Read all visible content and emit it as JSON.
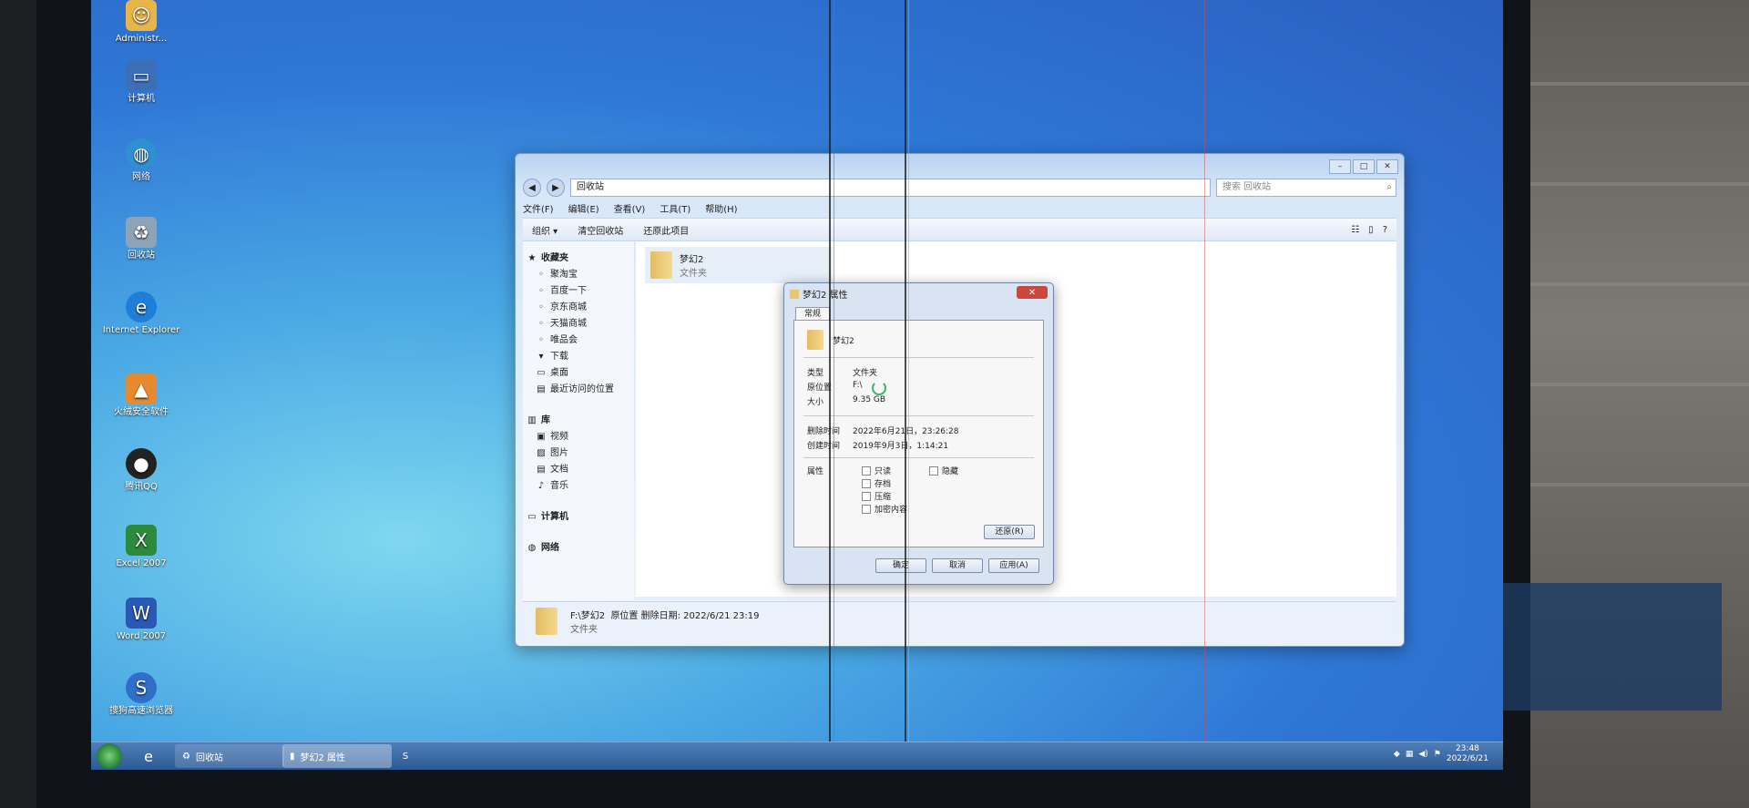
{
  "desktop_icons": [
    {
      "label": "Administr...",
      "icon": "user-icon"
    },
    {
      "label": "计算机",
      "icon": "computer-icon"
    },
    {
      "label": "网络",
      "icon": "network-icon"
    },
    {
      "label": "回收站",
      "icon": "recycle-bin-icon"
    },
    {
      "label": "Internet Explorer",
      "icon": "ie-icon"
    },
    {
      "label": "火绒安全软件",
      "icon": "huorong-icon"
    },
    {
      "label": "腾讯QQ",
      "icon": "qq-icon"
    },
    {
      "label": "Excel 2007",
      "icon": "excel-icon"
    },
    {
      "label": "Word 2007",
      "icon": "word-icon"
    },
    {
      "label": "搜狗高速浏览器",
      "icon": "sogou-icon"
    }
  ],
  "explorer": {
    "address": "回收站",
    "search_placeholder": "搜索 回收站",
    "menu": [
      "文件(F)",
      "编辑(E)",
      "查看(V)",
      "工具(T)",
      "帮助(H)"
    ],
    "toolbar": {
      "organize": "组织 ▾",
      "empty": "清空回收站",
      "restore": "还原此项目"
    },
    "nav": {
      "favorites_title": "收藏夹",
      "favorites": [
        "聚淘宝",
        "百度一下",
        "京东商城",
        "天猫商城",
        "唯品会",
        "下载",
        "桌面",
        "最近访问的位置"
      ],
      "library_title": "库",
      "library": [
        "视频",
        "图片",
        "文档",
        "音乐"
      ],
      "computer": "计算机",
      "network": "网络"
    },
    "file": {
      "name": "梦幻2",
      "type": "文件夹"
    },
    "status": {
      "path": "F:\\梦幻2",
      "date_label": "原位置  删除日期: 2022/6/21 23:19",
      "type": "文件夹"
    }
  },
  "properties": {
    "title": "梦幻2 属性",
    "close": "✕",
    "tab": "常规",
    "name": "梦幻2",
    "type_k": "类型",
    "type_v": "文件夹",
    "location_k": "原位置",
    "location_v": "F:\\",
    "size_k": "大小",
    "size_v": "9.35 GB",
    "modified_k": "删除时间",
    "modified_v": "2022年6月21日，23:26:28",
    "created_k": "创建时间",
    "created_v": "2019年9月3日，1:14:21",
    "attr_k": "属性",
    "attrs": [
      "只读",
      "存档",
      "压缩",
      "加密内容"
    ],
    "hidden": "隐藏",
    "restore_btn": "还原(R)",
    "ok": "确定",
    "cancel": "取消",
    "apply": "应用(A)"
  },
  "taskbar": {
    "items": [
      {
        "label": "回收站",
        "icon": "recycle-bin-icon"
      },
      {
        "label": "梦幻2 属性",
        "icon": "folder-icon"
      }
    ],
    "time": "23:48",
    "date": "2022/6/21"
  }
}
